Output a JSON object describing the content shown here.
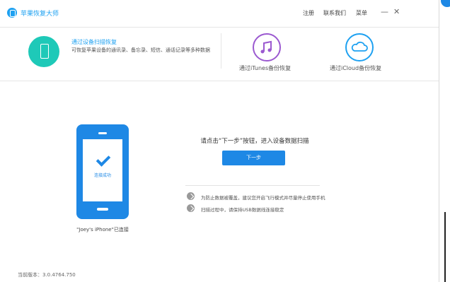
{
  "app": {
    "title": "苹果恢复大师"
  },
  "titlebar": {
    "register": "注册",
    "contact": "联系我们",
    "menu": "菜单",
    "minimize": "—",
    "close": "✕"
  },
  "modes": {
    "device": {
      "title": "通过设备扫描恢复",
      "desc": "可恢复苹果设备的通讯录、备忘录、短信、通话记录等多种数据"
    },
    "itunes": {
      "label": "通过iTunes备份恢复"
    },
    "icloud": {
      "label": "通过iCloud备份恢复"
    }
  },
  "device": {
    "status": "连接成功",
    "caption": "\"Joey's iPhone\"已连接"
  },
  "main": {
    "prompt": "请点击“下一步”按钮，进入设备数据扫描",
    "next_button": "下一步",
    "tips": [
      "为防止数据被覆盖，建议您开启飞行模式并尽量停止使用手机",
      "扫描过程中，请保持USB数据线连接稳定"
    ]
  },
  "footer": {
    "version": "当前版本：3.0.4764.750"
  },
  "colors": {
    "accent": "#1e88e5",
    "teal": "#1ec9b8",
    "purple": "#9b59d0"
  }
}
